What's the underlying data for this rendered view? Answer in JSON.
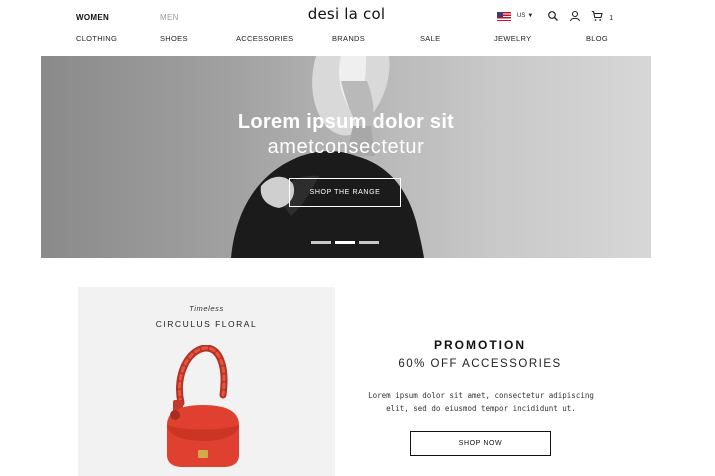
{
  "header": {
    "brand": "desi la col",
    "gender_tabs": [
      "WOMEN",
      "MEN"
    ],
    "locale": "US",
    "cart_count": "1",
    "icons": [
      "us-flag-icon",
      "chevron-down-icon",
      "search-icon",
      "user-icon",
      "cart-icon"
    ]
  },
  "nav": {
    "items": [
      "CLOTHING",
      "SHOES",
      "ACCESSORIES",
      "BRANDS",
      "SALE",
      "JEWELRY",
      "BLOG"
    ]
  },
  "hero": {
    "title": "Lorem ipsum dolor sit",
    "subtitle": "ametconsectetur",
    "cta": "SHOP THE RANGE",
    "active_slide": 2,
    "slide_count": 3
  },
  "product": {
    "tag": "Timeless",
    "name": "CIRCULUS FLORAL"
  },
  "promotion": {
    "title": "PROMOTION",
    "subtitle": "60% OFF ACCESSORIES",
    "text": "Lorem ipsum dolor sit amet, consectetur adipiscing elit, sed do eiusmod tempor incididunt ut.",
    "cta": "SHOP NOW"
  },
  "colors": {
    "text": "#1a1a1a",
    "muted": "#9a9a9a",
    "card_bg": "#f2f2f2",
    "bag_red": "#d93a2b"
  }
}
